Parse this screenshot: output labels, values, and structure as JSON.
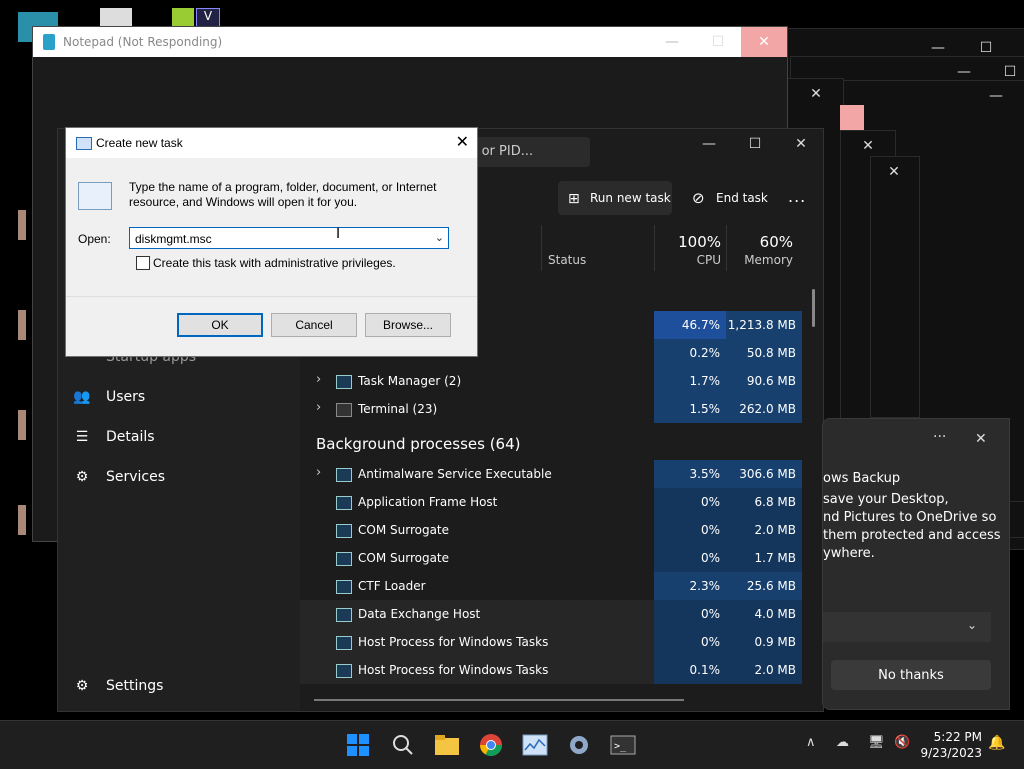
{
  "notepad": {
    "title": "Notepad (Not Responding)"
  },
  "task_manager": {
    "search_placeholder": "er, or PID...",
    "toolbar": {
      "run_new_task": "Run new task",
      "end_task": "End task",
      "more": "..."
    },
    "columns": {
      "status": "Status",
      "cpu_pct": "100%",
      "cpu": "CPU",
      "mem_pct": "60%",
      "memory": "Memory"
    },
    "sidebar": {
      "startup_apps": "Startup apps",
      "users": "Users",
      "details": "Details",
      "services": "Services",
      "settings": "Settings"
    },
    "app_rows": [
      {
        "name": "",
        "cpu": "46.7%",
        "mem": "1,213.8 MB"
      },
      {
        "name": "",
        "cpu": "0.2%",
        "mem": "50.8 MB"
      },
      {
        "name": "Task Manager (2)",
        "cpu": "1.7%",
        "mem": "90.6 MB"
      },
      {
        "name": "Terminal (23)",
        "cpu": "1.5%",
        "mem": "262.0 MB"
      }
    ],
    "background_header": "Background processes (64)",
    "bg_rows": [
      {
        "name": "Antimalware Service Executable",
        "cpu": "3.5%",
        "mem": "306.6 MB"
      },
      {
        "name": "Application Frame Host",
        "cpu": "0%",
        "mem": "6.8 MB"
      },
      {
        "name": "COM Surrogate",
        "cpu": "0%",
        "mem": "2.0 MB"
      },
      {
        "name": "COM Surrogate",
        "cpu": "0%",
        "mem": "1.7 MB"
      },
      {
        "name": "CTF Loader",
        "cpu": "2.3%",
        "mem": "25.6 MB"
      },
      {
        "name": "Data Exchange Host",
        "cpu": "0%",
        "mem": "4.0 MB"
      },
      {
        "name": "Host Process for Windows Tasks",
        "cpu": "0%",
        "mem": "0.9 MB"
      },
      {
        "name": "Host Process for Windows Tasks",
        "cpu": "0.1%",
        "mem": "2.0 MB"
      }
    ]
  },
  "dialog": {
    "title": "Create new task",
    "description": "Type the name of a program, folder, document, or Internet resource, and Windows will open it for you.",
    "open_label": "Open:",
    "open_value": "diskmgmt.msc",
    "admin_checkbox": "Create this task with administrative privileges.",
    "ok": "OK",
    "cancel": "Cancel",
    "browse": "Browse..."
  },
  "notification": {
    "title": "ows Backup",
    "body": "save your Desktop,\nnd Pictures to OneDrive so\nthem protected and access\nywhere.",
    "no_thanks": "No thanks"
  },
  "taskbar": {
    "time": "5:22 PM",
    "date": "9/23/2023"
  },
  "colors": {
    "cpu_high": "#1d4f9a",
    "cpu_low": "#17406e",
    "accent": "#0067c0"
  }
}
